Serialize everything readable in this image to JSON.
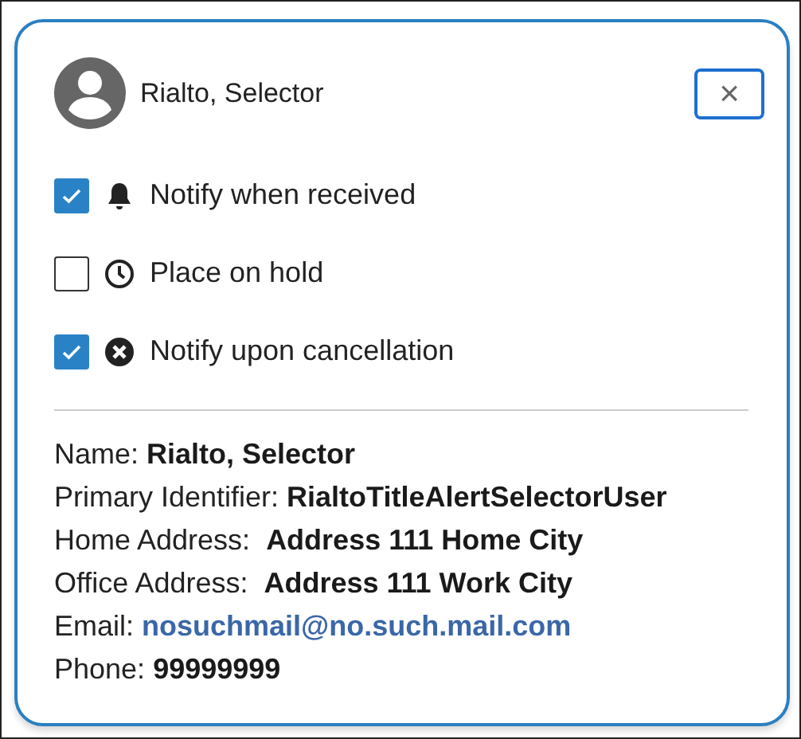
{
  "header": {
    "name": "Rialto, Selector",
    "close_label": "×"
  },
  "options": [
    {
      "label": "Notify when received",
      "checked": true,
      "kind": "bell"
    },
    {
      "label": "Place on hold",
      "checked": false,
      "kind": "clock"
    },
    {
      "label": "Notify upon cancellation",
      "checked": true,
      "kind": "cancel"
    }
  ],
  "details": [
    {
      "label": "Name:",
      "value": "Rialto, Selector",
      "kind": "text"
    },
    {
      "label": "Primary Identifier:",
      "value": "RialtoTitleAlertSelectorUser",
      "kind": "text"
    },
    {
      "label": "Home Address: ",
      "value": "Address 111 Home City",
      "kind": "text"
    },
    {
      "label": "Office Address: ",
      "value": "Address 111 Work City",
      "kind": "text"
    },
    {
      "label": "Email:",
      "value": "nosuchmail@no.such.mail.com",
      "kind": "link"
    },
    {
      "label": "Phone:",
      "value": "99999999",
      "kind": "text"
    }
  ]
}
